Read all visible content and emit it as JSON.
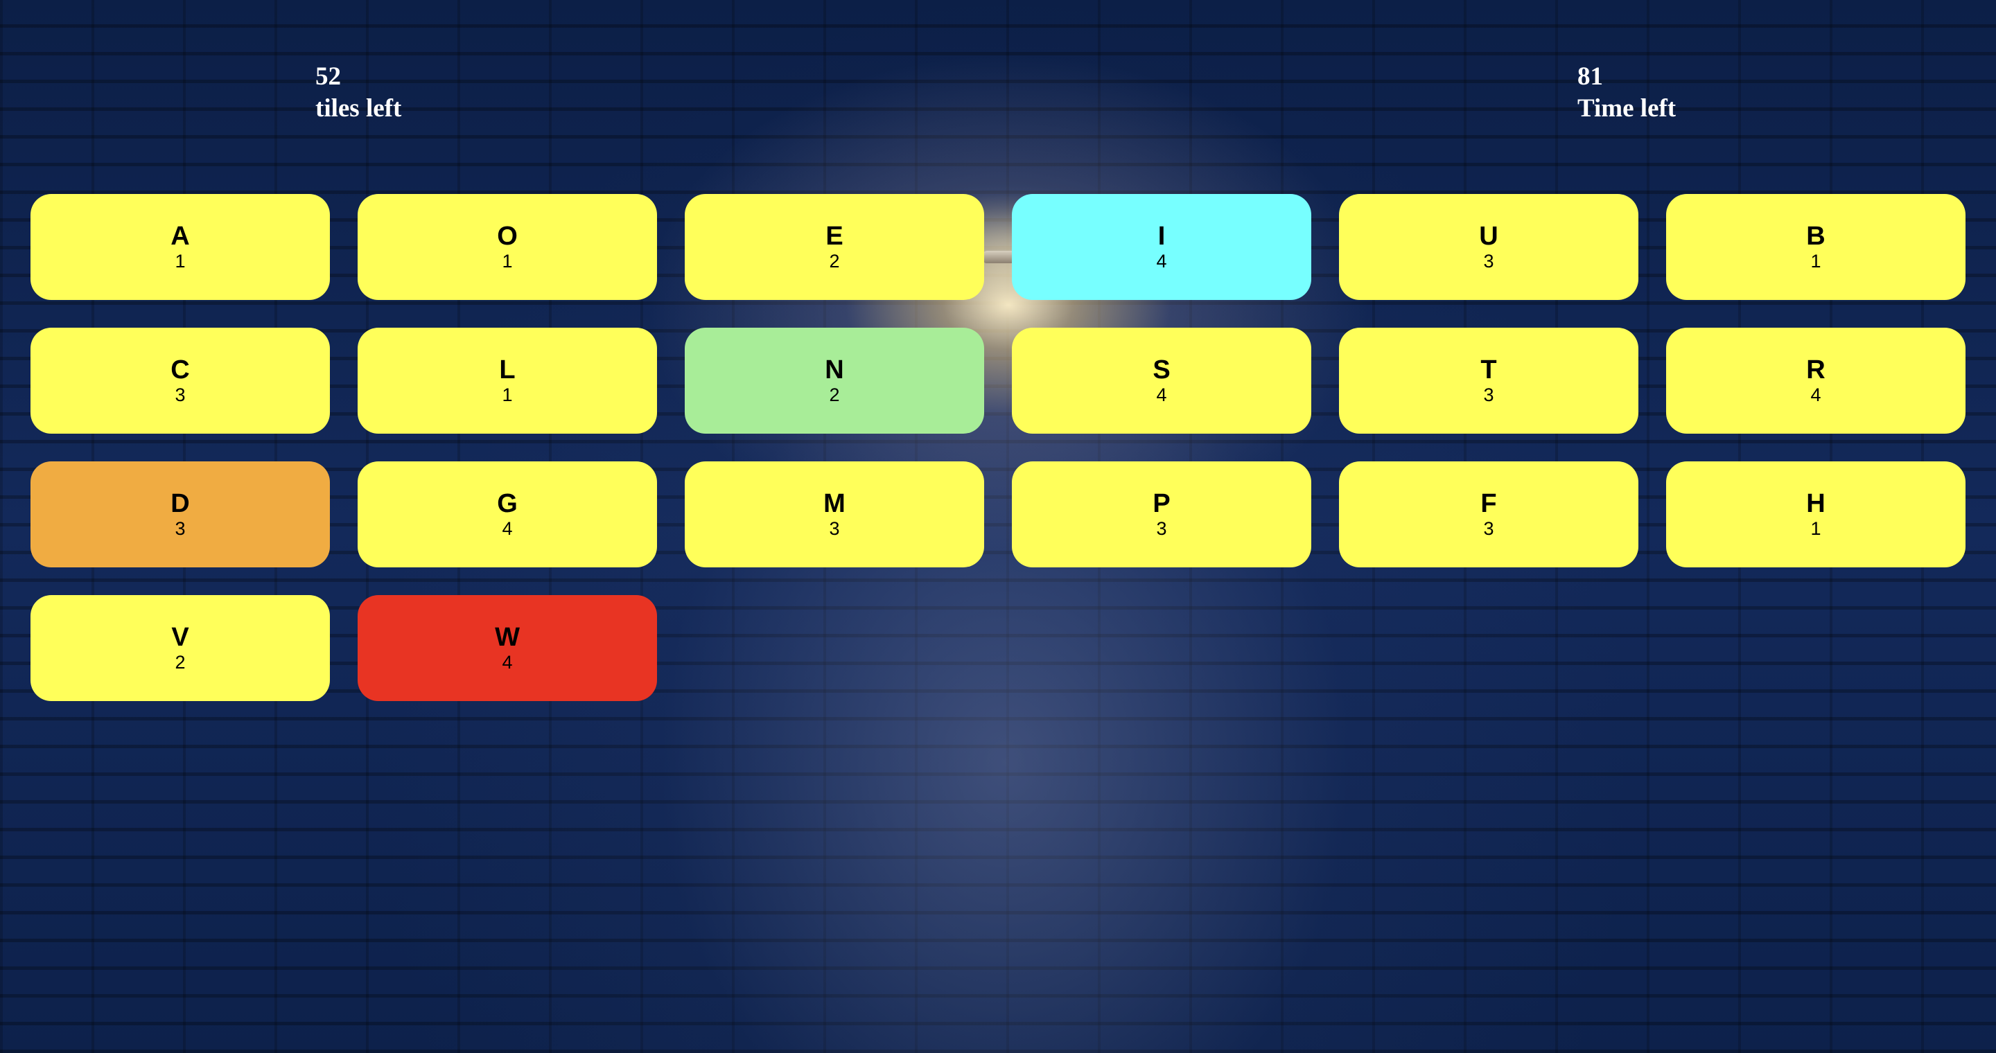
{
  "stats": {
    "tiles_left_value": "52",
    "tiles_left_label": "tiles left",
    "time_left_value": "81",
    "time_left_label": "Time left"
  },
  "colors": {
    "default_tile": "#ffff5a",
    "cyan": "#77ffff",
    "green": "#a8ed98",
    "orange": "#f0ac42",
    "red": "#e83423"
  },
  "tiles": [
    {
      "letter": "A",
      "points": "1",
      "color": "#ffff5a"
    },
    {
      "letter": "O",
      "points": "1",
      "color": "#ffff5a"
    },
    {
      "letter": "E",
      "points": "2",
      "color": "#ffff5a"
    },
    {
      "letter": "I",
      "points": "4",
      "color": "#77ffff"
    },
    {
      "letter": "U",
      "points": "3",
      "color": "#ffff5a"
    },
    {
      "letter": "B",
      "points": "1",
      "color": "#ffff5a"
    },
    {
      "letter": "C",
      "points": "3",
      "color": "#ffff5a"
    },
    {
      "letter": "L",
      "points": "1",
      "color": "#ffff5a"
    },
    {
      "letter": "N",
      "points": "2",
      "color": "#a8ed98"
    },
    {
      "letter": "S",
      "points": "4",
      "color": "#ffff5a"
    },
    {
      "letter": "T",
      "points": "3",
      "color": "#ffff5a"
    },
    {
      "letter": "R",
      "points": "4",
      "color": "#ffff5a"
    },
    {
      "letter": "D",
      "points": "3",
      "color": "#f0ac42"
    },
    {
      "letter": "G",
      "points": "4",
      "color": "#ffff5a"
    },
    {
      "letter": "M",
      "points": "3",
      "color": "#ffff5a"
    },
    {
      "letter": "P",
      "points": "3",
      "color": "#ffff5a"
    },
    {
      "letter": "F",
      "points": "3",
      "color": "#ffff5a"
    },
    {
      "letter": "H",
      "points": "1",
      "color": "#ffff5a"
    },
    {
      "letter": "V",
      "points": "2",
      "color": "#ffff5a"
    },
    {
      "letter": "W",
      "points": "4",
      "color": "#e83423"
    }
  ]
}
